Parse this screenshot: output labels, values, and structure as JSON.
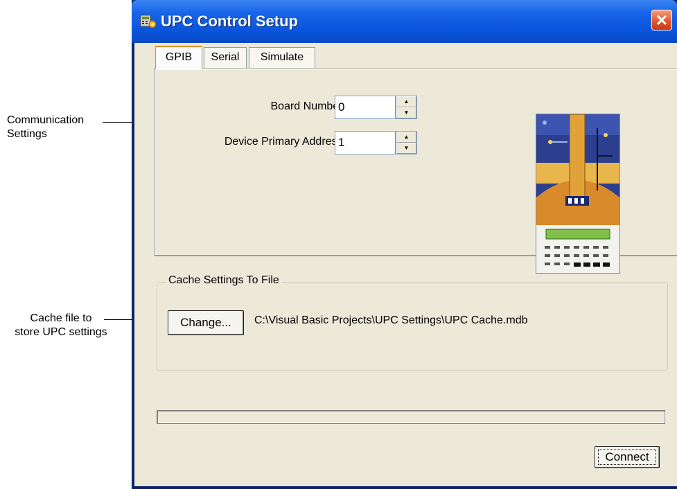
{
  "annotations": {
    "communication_line1": "Communication",
    "communication_line2": "Settings",
    "cache_line1": "Cache file to",
    "cache_line2": "store UPC settings"
  },
  "window": {
    "title": "UPC Control Setup",
    "close_symbol": "✕"
  },
  "tabs": [
    {
      "label": "GPIB",
      "active": true
    },
    {
      "label": "Serial",
      "active": false
    },
    {
      "label": "Simulate",
      "active": false
    }
  ],
  "gpib": {
    "board_number_label": "Board Number:",
    "board_number_value": "0",
    "device_address_label": "Device Primary Address:",
    "device_address_value": "1"
  },
  "cache": {
    "group_title": "Cache Settings To File",
    "change_button": "Change...",
    "file_path": "C:\\Visual Basic Projects\\UPC Settings\\UPC Cache.mdb"
  },
  "progress": {
    "value": 0
  },
  "connect_button": "Connect",
  "icons": {
    "spin_up": "up-arrow-icon",
    "spin_down": "down-arrow-icon",
    "app": "app-icon"
  },
  "colors": {
    "titlebar": "#0a55dd",
    "client_bg": "#ece9d8",
    "tab_accent": "#e68b2c",
    "close_button": "#e0542b"
  }
}
